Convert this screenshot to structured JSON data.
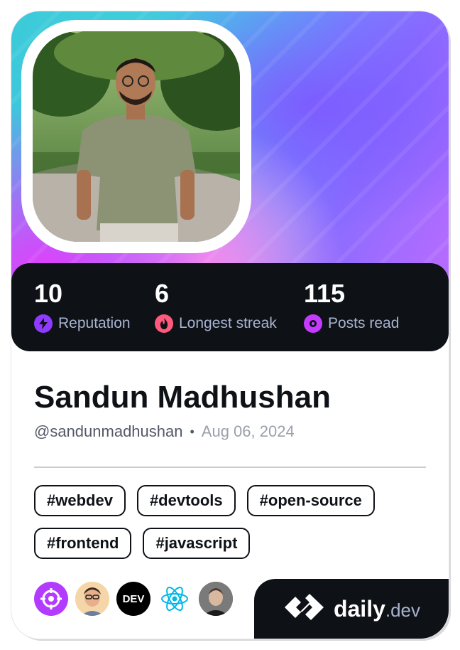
{
  "profile": {
    "name": "Sandun Madhushan",
    "handle": "@sandunmadhushan",
    "separator": "•",
    "joined": "Aug 06, 2024"
  },
  "stats": [
    {
      "value": "10",
      "label": "Reputation",
      "icon": "lightning-icon",
      "color": "#8e3bff"
    },
    {
      "value": "6",
      "label": "Longest streak",
      "icon": "flame-icon",
      "color": "#ff5a7d"
    },
    {
      "value": "115",
      "label": "Posts read",
      "icon": "eye-icon",
      "color": "#c43bff"
    }
  ],
  "tags": [
    "#webdev",
    "#devtools",
    "#open-source",
    "#frontend",
    "#javascript"
  ],
  "sources": [
    {
      "name": "crosshair-logo",
      "label": ""
    },
    {
      "name": "memoji-avatar",
      "label": ""
    },
    {
      "name": "dev-logo",
      "label": "DEV"
    },
    {
      "name": "react-logo",
      "label": ""
    },
    {
      "name": "person-avatar",
      "label": ""
    }
  ],
  "brand": {
    "name": "daily",
    "tld": ".dev"
  },
  "colors": {
    "dark": "#0e1217",
    "muted": "#a8b3cf"
  }
}
